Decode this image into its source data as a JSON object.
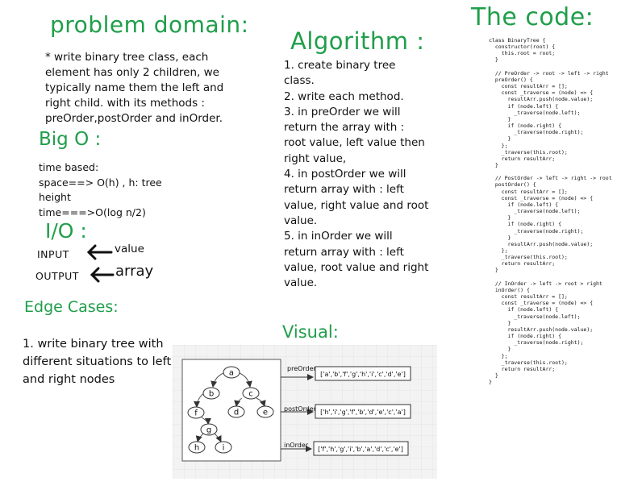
{
  "sections": {
    "problem_domain": "problem domain:",
    "algorithm": "Algorithm :",
    "code": "The code:",
    "big_o": "Big O :",
    "io": "I/O :",
    "edge_cases": "Edge Cases:",
    "visual": "Visual:"
  },
  "problem_domain_text": "* write binary tree class,  each element  has only 2 children, we typically name them the left and right child. with its methods : preOrder,postOrder and inOrder.",
  "algorithm_steps": [
    "1. create binary tree class.",
    "2. write each method.",
    "3. in preOrder we will return the array with : root value, left value then right value,",
    "4. in postOrder we will return array with : left value, right value and root value.",
    "5. in inOrder we will return array with : left value, root value and right value."
  ],
  "big_o_lines": [
    "time based:",
    "space==> O(h) , h: tree height",
    "time===>O(log n/2)"
  ],
  "io": {
    "input_label": "INPUT",
    "input_value": "value",
    "output_label": "OUTPUT",
    "output_value": "array"
  },
  "edge_cases_text": "1. write binary tree with different situations to left and right nodes",
  "code_text": "class BinaryTree {\n  constructor(root) {\n    this.root = root;\n  }\n\n  // PreOrder -> root -> left -> right\n  preOrder() {\n    const resultArr = [];\n    const _traverse = (node) => {\n      resultArr.push(node.value);\n      if (node.left) {\n        _traverse(node.left);\n      }\n      if (node.right) {\n        _traverse(node.right);\n      }\n    };\n    _traverse(this.root);\n    return resultArr;\n  }\n\n  // PostOrder -> left -> right -> root\n  postOrder() {\n    const resultArr = [];\n    const _traverse = (node) => {\n      if (node.left) {\n        _traverse(node.left);\n      }\n      if (node.right) {\n        _traverse(node.right);\n      }\n      resultArr.push(node.value);\n    };\n    _traverse(this.root);\n    return resultArr;\n  }\n\n  // InOrder -> left -> root > right\n  inOrder() {\n    const resultArr = [];\n    const _traverse = (node) => {\n      if (node.left) {\n        _traverse(node.left);\n      }\n      resultArr.push(node.value);\n      if (node.right) {\n        _traverse(node.right);\n      }\n    };\n    _traverse(this.root);\n    return resultArr;\n  }\n}",
  "visual": {
    "nodes": [
      "a",
      "b",
      "c",
      "f",
      "d",
      "e",
      "g",
      "h",
      "i"
    ],
    "traversals": [
      {
        "label": "preOrder",
        "result": "['a','b','f','g','h','i','c','d','e']"
      },
      {
        "label": "postOrder",
        "result": "['h','i','g','f','b','d','e','c','a']"
      },
      {
        "label": "inOrder",
        "result": "['f','h','g','i','b','a','d','c','e']"
      }
    ]
  }
}
